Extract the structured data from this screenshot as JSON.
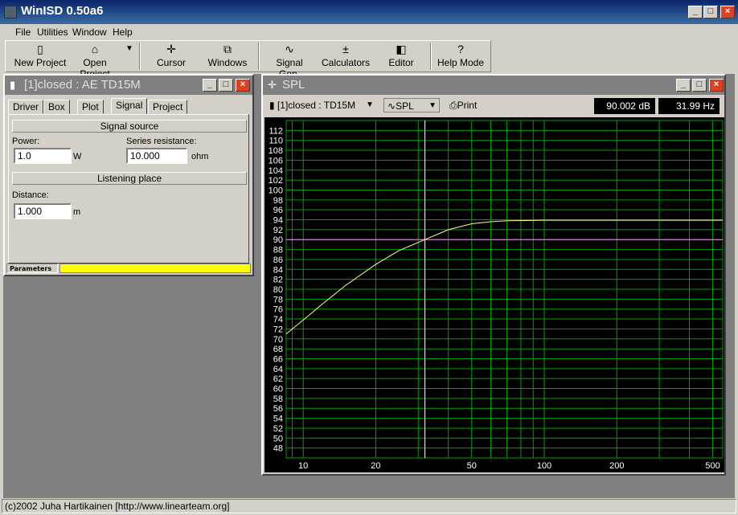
{
  "app": {
    "title": "WinISD 0.50a6",
    "status": "(c)2002 Juha Hartikainen [http://www.linearteam.org]"
  },
  "menu": [
    "File",
    "Utilities",
    "Window",
    "Help"
  ],
  "toolbar": [
    {
      "label": "New Project",
      "icon": "new-project-icon"
    },
    {
      "label": "Open Project",
      "icon": "open-folder-icon"
    },
    {
      "label": "Cursor",
      "icon": "cursor-icon"
    },
    {
      "label": "Windows",
      "icon": "windows-icon"
    },
    {
      "label": "Signal Gen.",
      "icon": "sine-wave-icon"
    },
    {
      "label": "Calculators",
      "icon": "calculator-icon"
    },
    {
      "label": "Editor",
      "icon": "editor-icon"
    },
    {
      "label": "Help Mode",
      "icon": "help-question-icon"
    }
  ],
  "project_window": {
    "title": "[1]closed : AE TD15M",
    "tabs": [
      "Driver",
      "Box",
      "Plot",
      "Signal",
      "Project"
    ],
    "active_tab": "Signal",
    "signal_source_title": "Signal source",
    "power_label": "Power:",
    "power_value": "1.0",
    "power_unit": "W",
    "resistance_label": "Series resistance:",
    "resistance_value": "10.000",
    "resistance_unit": "ohm",
    "listening_title": "Listening place",
    "distance_label": "Distance:",
    "distance_value": "1.000",
    "distance_unit": "m",
    "status_label": "Parameters"
  },
  "spl_window": {
    "title": "SPL",
    "project_select": "[1]closed : TD15M",
    "graph_select": "SPL",
    "print_label": "Print",
    "readout_db": "90.002 dB",
    "readout_hz": "31.99 Hz"
  },
  "colors": {
    "grid": "#00a000",
    "curve": "#ffff80",
    "cursor_h": "#ff80ff",
    "cursor_v": "#ffffff",
    "status_bar_fill": "#ffff00"
  },
  "chart_data": {
    "type": "line",
    "title": "SPL",
    "x_scale": "log",
    "xlim": [
      8.5,
      550
    ],
    "ylim": [
      46,
      114
    ],
    "x_tick_labels": [
      "10",
      "20",
      "50",
      "100",
      "200",
      "500"
    ],
    "x_ticks": [
      10,
      20,
      50,
      100,
      200,
      500
    ],
    "y_tick_labels": [
      "48",
      "50",
      "52",
      "54",
      "56",
      "58",
      "60",
      "62",
      "64",
      "66",
      "68",
      "70",
      "72",
      "74",
      "76",
      "78",
      "80",
      "82",
      "84",
      "86",
      "88",
      "90",
      "92",
      "94",
      "96",
      "98",
      "100",
      "102",
      "104",
      "106",
      "108",
      "110",
      "112"
    ],
    "series": [
      {
        "x": [
          8.5,
          10,
          12,
          15,
          20,
          25,
          31.99,
          40,
          50,
          60,
          70,
          100,
          200,
          550
        ],
        "y": [
          71,
          73.8,
          77,
          80.8,
          85,
          87.8,
          90.0,
          92.0,
          93.2,
          93.6,
          93.8,
          93.9,
          93.9,
          93.9
        ]
      }
    ],
    "cursor": {
      "x": 31.99,
      "y": 90.002
    }
  }
}
